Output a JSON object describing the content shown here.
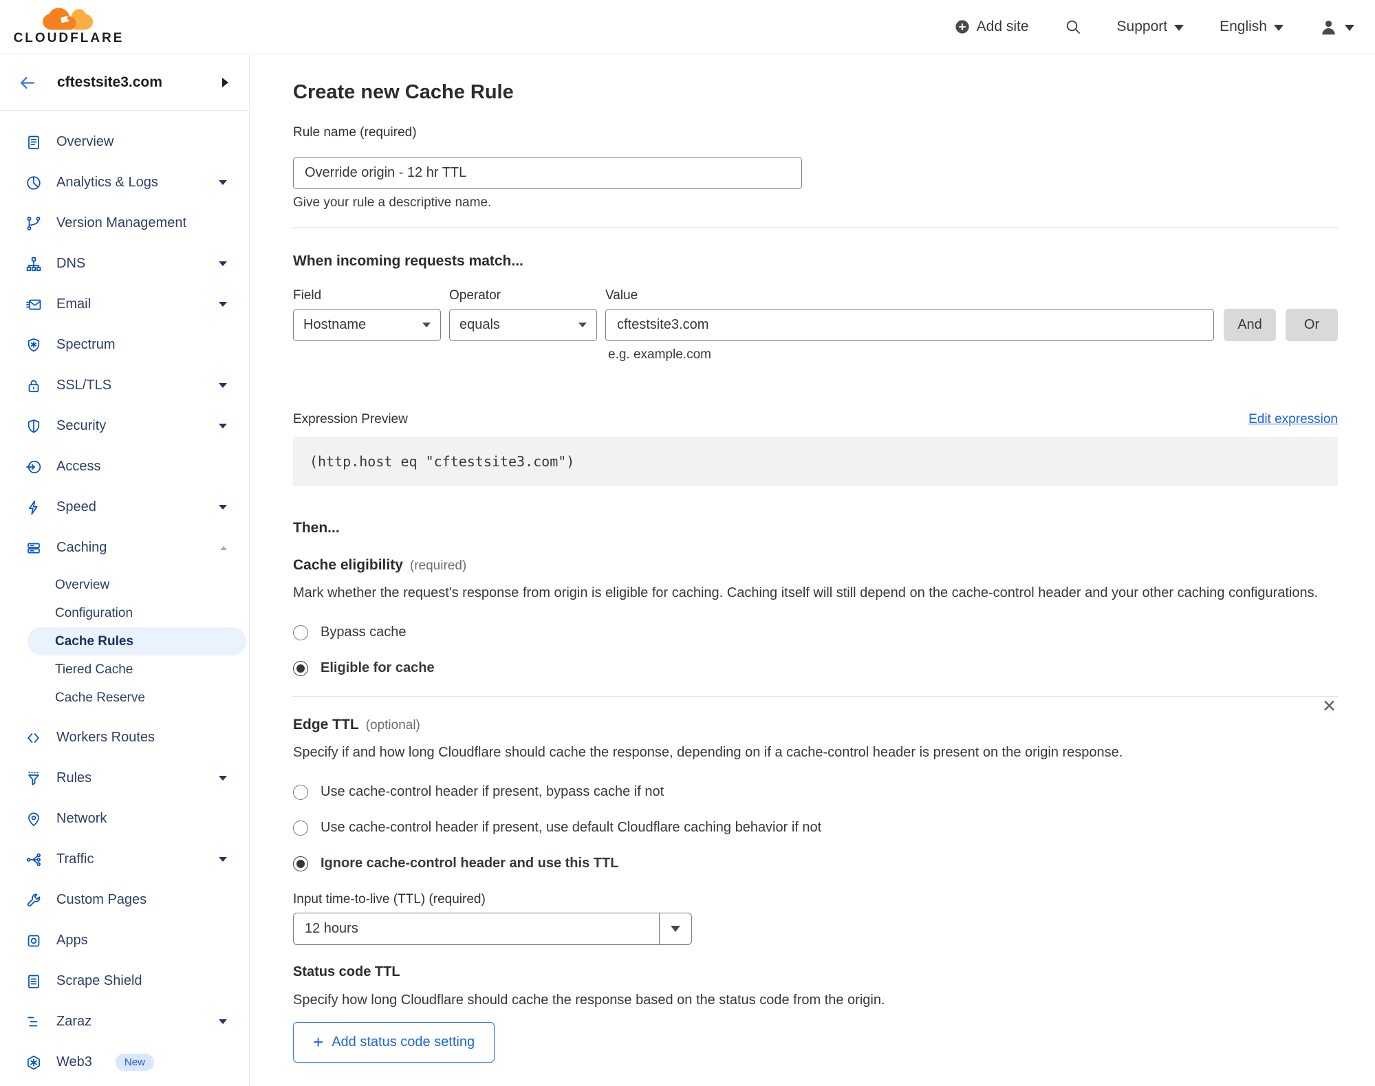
{
  "topbar": {
    "brand": "CLOUDFLARE",
    "add_site_label": "Add site",
    "support_label": "Support",
    "language_label": "English"
  },
  "sidebar": {
    "site_name": "cftestsite3.com",
    "items": [
      {
        "label": "Overview"
      },
      {
        "label": "Analytics & Logs",
        "chevron": true
      },
      {
        "label": "Version Management"
      },
      {
        "label": "DNS",
        "chevron": true
      },
      {
        "label": "Email",
        "chevron": true
      },
      {
        "label": "Spectrum"
      },
      {
        "label": "SSL/TLS",
        "chevron": true
      },
      {
        "label": "Security",
        "chevron": true
      },
      {
        "label": "Access"
      },
      {
        "label": "Speed",
        "chevron": true
      },
      {
        "label": "Caching",
        "expanded": true
      },
      {
        "label": "Workers Routes"
      },
      {
        "label": "Rules",
        "chevron": true
      },
      {
        "label": "Network"
      },
      {
        "label": "Traffic",
        "chevron": true
      },
      {
        "label": "Custom Pages"
      },
      {
        "label": "Apps"
      },
      {
        "label": "Scrape Shield"
      },
      {
        "label": "Zaraz",
        "chevron": true
      },
      {
        "label": "Web3",
        "badge": "New"
      }
    ],
    "caching_subitems": [
      "Overview",
      "Configuration",
      "Cache Rules",
      "Tiered Cache",
      "Cache Reserve"
    ],
    "active_subitem": "Cache Rules"
  },
  "main": {
    "title": "Create new Cache Rule",
    "rule_name": {
      "label": "Rule name (required)",
      "value": "Override origin - 12 hr TTL",
      "help": "Give your rule a descriptive name."
    },
    "match": {
      "heading": "When incoming requests match...",
      "field_label": "Field",
      "operator_label": "Operator",
      "value_label": "Value",
      "field_value": "Hostname",
      "operator_value": "equals",
      "value_value": "cftestsite3.com",
      "value_help": "e.g. example.com",
      "and_label": "And",
      "or_label": "Or"
    },
    "expression": {
      "label": "Expression Preview",
      "edit_link": "Edit expression",
      "code": "(http.host eq \"cftestsite3.com\")"
    },
    "then_heading": "Then...",
    "cache_eligibility": {
      "heading": "Cache eligibility",
      "required_tag": "(required)",
      "description": "Mark whether the request's response from origin is eligible for caching. Caching itself will still depend on the cache-control header and your other caching configurations.",
      "options": [
        {
          "label": "Bypass cache",
          "selected": false
        },
        {
          "label": "Eligible for cache",
          "selected": true
        }
      ]
    },
    "edge_ttl": {
      "heading": "Edge TTL",
      "optional_tag": "(optional)",
      "description": "Specify if and how long Cloudflare should cache the response, depending on if a cache-control header is present on the origin response.",
      "options": [
        {
          "label": "Use cache-control header if present, bypass cache if not",
          "selected": false
        },
        {
          "label": "Use cache-control header if present, use default Cloudflare caching behavior if not",
          "selected": false
        },
        {
          "label": "Ignore cache-control header and use this TTL",
          "selected": true
        }
      ],
      "ttl_label": "Input time-to-live (TTL) (required)",
      "ttl_value": "12 hours"
    },
    "status_code_ttl": {
      "heading": "Status code TTL",
      "description": "Specify how long Cloudflare should cache the response based on the status code from the origin.",
      "add_button": "Add status code setting"
    }
  },
  "colors": {
    "brand_orange": "#f6821f",
    "brand_orange_light": "#fbad41",
    "icon_blue": "#0051c3",
    "sidebar_text": "#2f3f63",
    "active_item_bg": "#e9f2fd",
    "link_blue": "#1f62e0",
    "button_blue_border": "#3072e3"
  }
}
